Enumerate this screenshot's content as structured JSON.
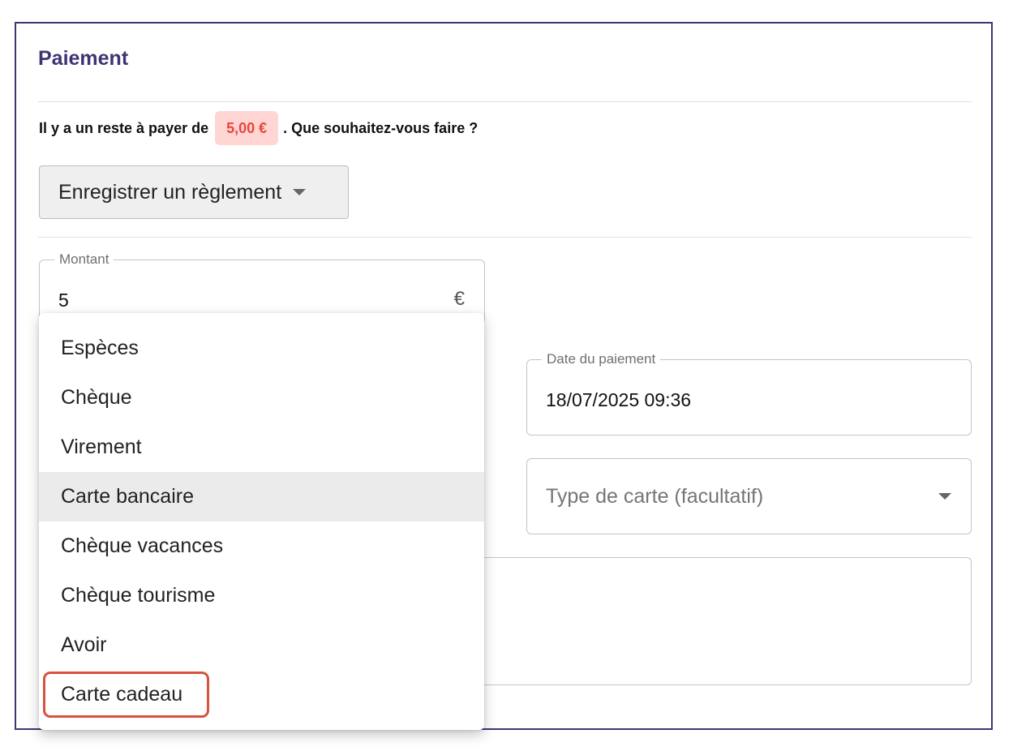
{
  "section": {
    "title": "Paiement"
  },
  "message": {
    "before": "Il y a un reste à payer de",
    "amount": "5,00 €",
    "after": ". Que souhaitez-vous faire ?"
  },
  "action": {
    "label": "Enregistrer un règlement"
  },
  "amount_field": {
    "label": "Montant",
    "value": "5",
    "currency": "€"
  },
  "date_field": {
    "label": "Date du paiement",
    "value": "18/07/2025 09:36"
  },
  "card_type_field": {
    "placeholder": "Type de carte (facultatif)"
  },
  "payment_methods": {
    "items": [
      {
        "label": "Espèces"
      },
      {
        "label": "Chèque"
      },
      {
        "label": "Virement"
      },
      {
        "label": "Carte bancaire"
      },
      {
        "label": "Chèque vacances"
      },
      {
        "label": "Chèque tourisme"
      },
      {
        "label": "Avoir"
      },
      {
        "label": "Carte cadeau"
      }
    ],
    "hovered": "Carte bancaire",
    "highlighted": "Carte cadeau"
  },
  "colors": {
    "accent": "#3d3573",
    "badge_bg": "#ffd6d3",
    "badge_text": "#e8463c",
    "highlight_border": "#d8533f"
  }
}
